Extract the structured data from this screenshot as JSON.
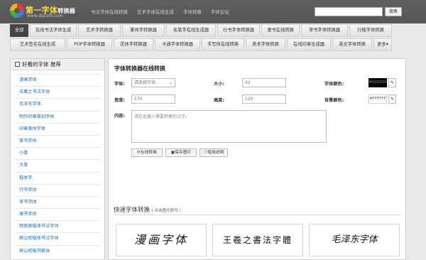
{
  "header": {
    "logo_title": "第一字体",
    "logo_title_suffix": "转换器",
    "logo_url": "www.diyiziti.com",
    "nav": [
      "书法字体在线转换",
      "艺术字体在线生成",
      "字体转换",
      "字体论坛"
    ],
    "search_placeholder": "",
    "search_button": "搜索"
  },
  "categories": {
    "row1": [
      "全部",
      "在线书法字体生成",
      "艺术字转换器",
      "篆体字转换器",
      "毛笔字在线生成器",
      "行书字体转换器",
      "隶书在线转换",
      "草书字体转换器",
      "行楷字体转换"
    ],
    "row2": [
      "艺术签名在线生成",
      "POP字体转换器",
      "花体字转换器",
      "卡通字体转换器",
      "手写体在线转换",
      "美术字体转换",
      "在线印章生成器",
      "英文字体转换",
      "更多▾"
    ]
  },
  "sidebar": {
    "title": "好看的字体 推荐",
    "items": [
      "漫画字体",
      "王羲之书法字体",
      "毛泽东字体",
      "制作印章篆刻字体",
      "印章篆体字体",
      "篆书字体",
      "小篆",
      "大篆",
      "楷体字",
      "行书字体",
      "草书字体",
      "隶书字体",
      "颜真卿楷体书法字体",
      "柳公权楷体书法字体",
      "柳公权楷书繁体"
    ]
  },
  "converter": {
    "title": "字体转换器在线转换",
    "font_label": "字体:",
    "font_select": "请选择字体...",
    "size_label": "大小:",
    "size_value": "42",
    "color_label": "字体颜色:",
    "color_value": "#000000",
    "width_label": "宽度:",
    "width_value": "570",
    "height_label": "高度:",
    "height_value": "120",
    "bg_label": "背景颜色:",
    "bg_value": "#FFFFFF",
    "content_label": "内容:",
    "content_placeholder": "请在此输入需要转换的文字。",
    "btn_convert": "在线转换",
    "btn_save": "保存图片",
    "btn_help": "使用说明"
  },
  "quick": {
    "title": "快速字体转换",
    "hint": "( 点击图片即可 )",
    "samples": [
      "漫画字体",
      "王羲之書法字體",
      "毛泽东字体"
    ]
  }
}
